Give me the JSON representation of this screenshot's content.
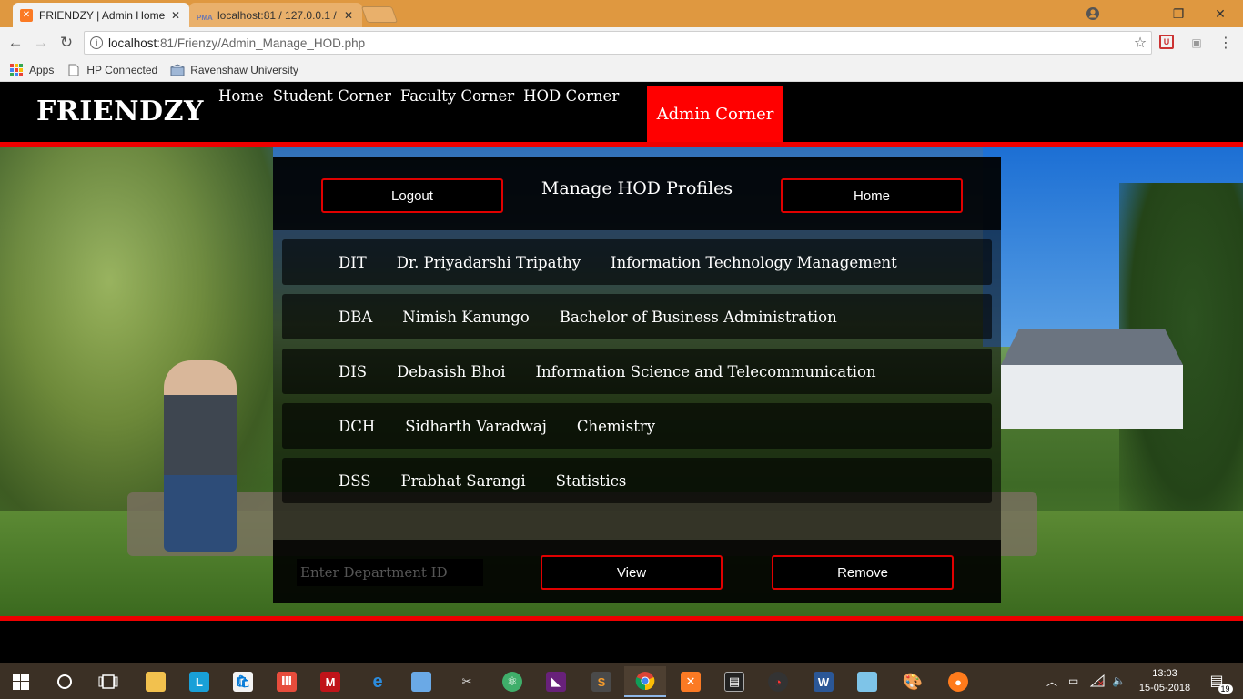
{
  "browser": {
    "tabs": [
      {
        "label": "FRIENDZY | Admin Home",
        "icon": "xampp-icon"
      },
      {
        "label": "localhost:81 / 127.0.0.1 /",
        "icon": "phpmyadmin-icon"
      }
    ],
    "url_host": "localhost",
    "url_path": ":81/Frienzy/Admin_Manage_HOD.php",
    "bookmarks": [
      {
        "label": "Apps",
        "icon": "apps-grid-icon"
      },
      {
        "label": "HP Connected",
        "icon": "page-icon"
      },
      {
        "label": "Ravenshaw University",
        "icon": "ravenshaw-icon"
      }
    ]
  },
  "site": {
    "brand": "FRIENDZY",
    "nav": [
      "Home",
      "Student Corner",
      "Faculty Corner",
      "HOD Corner"
    ],
    "active_nav": "Admin Corner"
  },
  "panel": {
    "title": "Manage HOD Profiles",
    "logout_label": "Logout",
    "home_label": "Home",
    "hods": [
      {
        "id": "DIT",
        "name": "Dr. Priyadarshi Tripathy",
        "department": "Information Technology Management"
      },
      {
        "id": "DBA",
        "name": "Nimish Kanungo",
        "department": "Bachelor of Business Administration"
      },
      {
        "id": "DIS",
        "name": "Debasish Bhoi",
        "department": "Information Science and Telecommunication"
      },
      {
        "id": "DCH",
        "name": "Sidharth Varadwaj",
        "department": "Chemistry"
      },
      {
        "id": "DSS",
        "name": "Prabhat Sarangi",
        "department": "Statistics"
      }
    ],
    "input_placeholder": "Enter Department ID",
    "view_label": "View",
    "remove_label": "Remove"
  },
  "taskbar": {
    "time": "13:03",
    "date": "15-05-2018",
    "notifications": "19"
  },
  "colors": {
    "accent": "#ee0000",
    "tabstrip": "#df9840",
    "taskbar": "#3b3025"
  }
}
